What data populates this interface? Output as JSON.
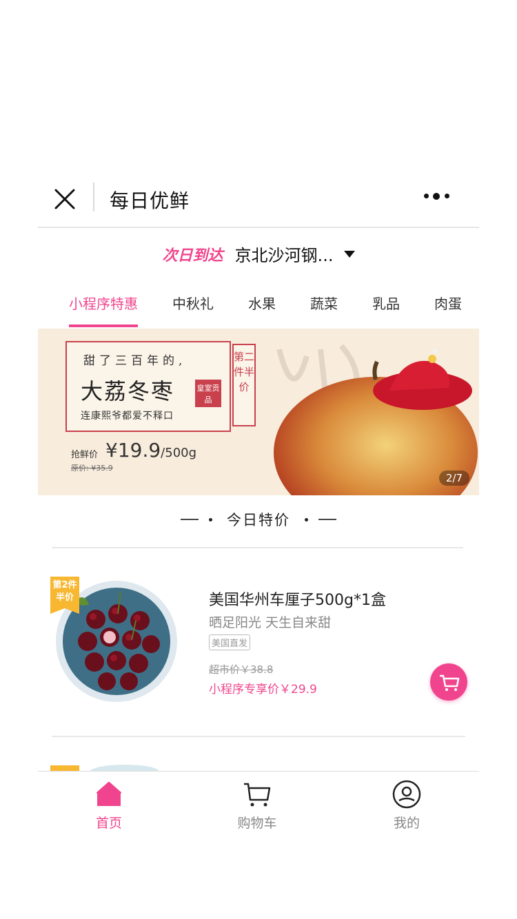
{
  "navbar": {
    "title": "每日优鲜",
    "close_icon": "close-icon",
    "more_icon": "more-icon"
  },
  "delivery": {
    "tag": "次日到达",
    "address": "京北沙河钢..."
  },
  "categories": [
    {
      "label": "小程序特惠",
      "active": true
    },
    {
      "label": "中秋礼",
      "active": false
    },
    {
      "label": "水果",
      "active": false
    },
    {
      "label": "蔬菜",
      "active": false
    },
    {
      "label": "乳品",
      "active": false
    },
    {
      "label": "肉蛋",
      "active": false
    }
  ],
  "banner": {
    "line1": "甜了三百年的,",
    "line2": "大荔冬枣",
    "line3": "连康熙爷都爱不释口",
    "seal": "皇室贡品",
    "vertical": "第二件半价",
    "price_label": "抢鲜价",
    "price": "¥19.9",
    "price_unit": "/500g",
    "original": "原价: ¥35.9",
    "indicator": "2/7"
  },
  "section": {
    "title": "今日特价"
  },
  "product": {
    "badge": "第2件半价",
    "name": "美国华州车厘子500g*1盒",
    "subtitle": "晒足阳光  天生自来甜",
    "tag": "美国直发",
    "original_price": "超市价￥38.8",
    "price": "小程序专享价￥29.9"
  },
  "tabbar": [
    {
      "label": "首页",
      "icon": "home-icon",
      "active": true
    },
    {
      "label": "购物车",
      "icon": "cart-icon",
      "active": false
    },
    {
      "label": "我的",
      "icon": "profile-icon",
      "active": false
    }
  ],
  "colors": {
    "accent": "#f0458e",
    "badge": "#f7b731",
    "banner_bg": "#f8ecdc",
    "seal_red": "#c8414d"
  }
}
